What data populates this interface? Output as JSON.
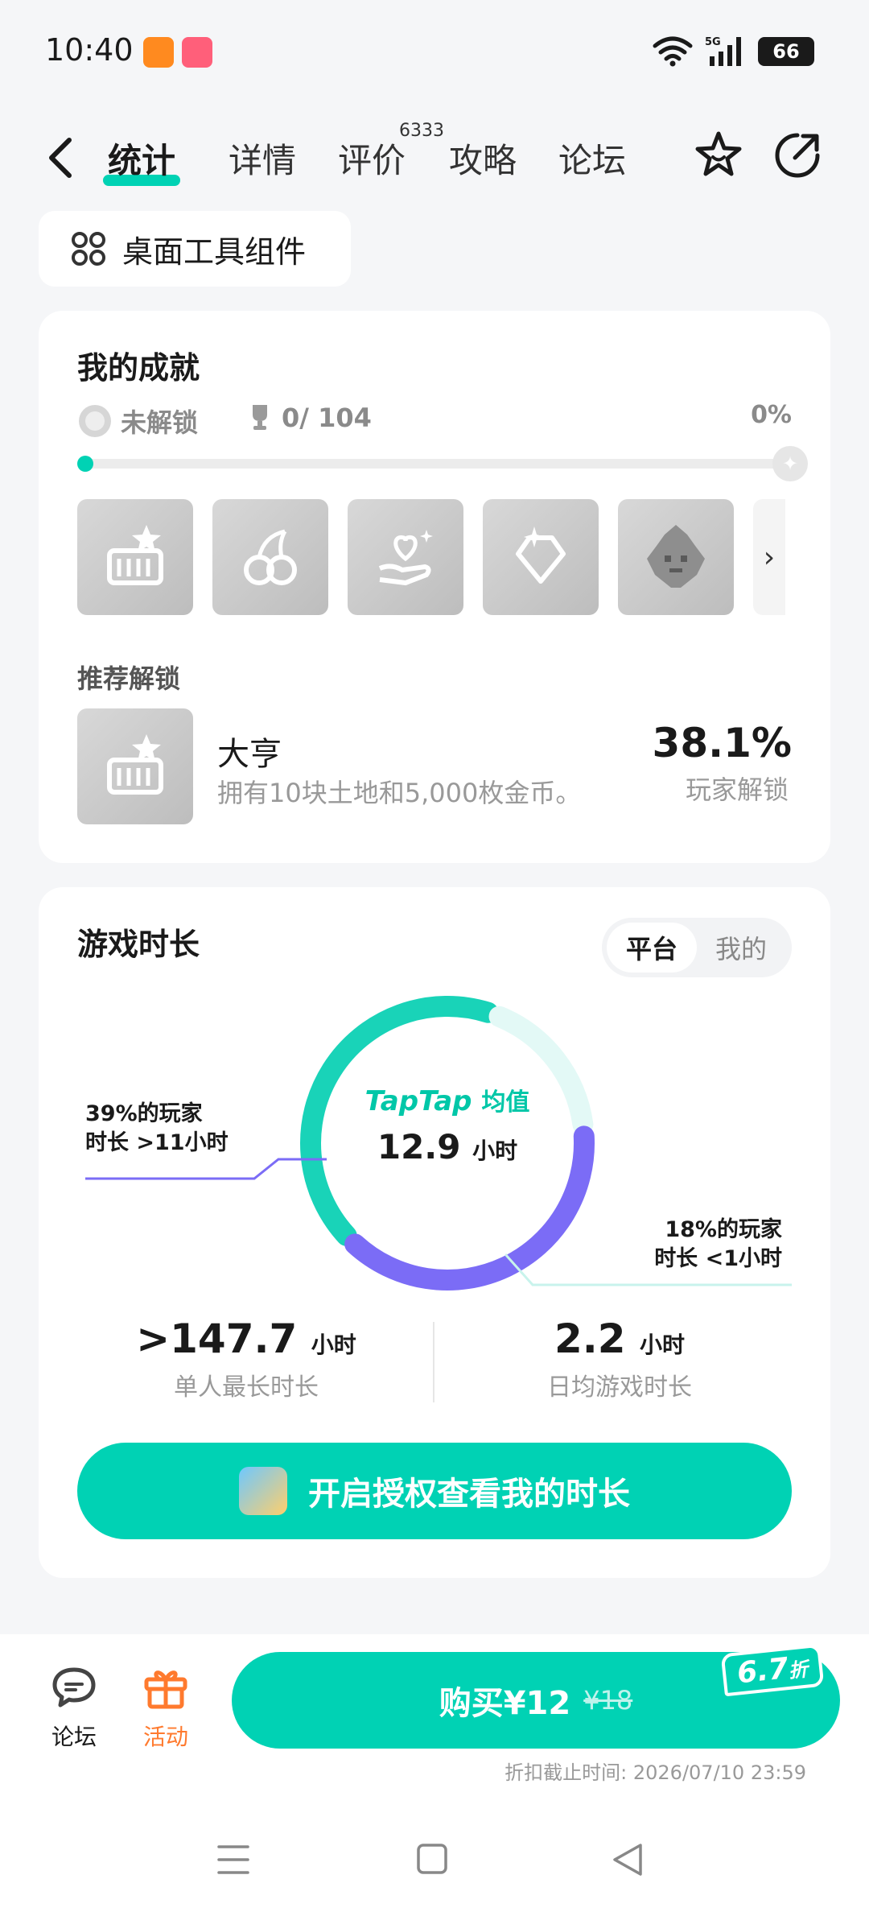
{
  "status_bar": {
    "time": "10:40",
    "battery": "66"
  },
  "nav": {
    "tabs": [
      {
        "label": "统计"
      },
      {
        "label": "详情"
      },
      {
        "label": "评价"
      },
      {
        "label": "攻略"
      },
      {
        "label": "论坛"
      }
    ],
    "review_count": "6333"
  },
  "widget_button": {
    "label": "桌面工具组件"
  },
  "achievements": {
    "title": "我的成就",
    "status": "未解锁",
    "count": "0/ 104",
    "percent": "0%",
    "progress": 0,
    "badge_count": 5,
    "recommend_title": "推荐解锁",
    "recommend": {
      "name": "大亨",
      "desc": "拥有10块土地和5,000枚金币。",
      "percent": "38.1%",
      "percent_label": "玩家解锁"
    }
  },
  "playtime": {
    "title": "游戏时长",
    "segment": {
      "active": "平台",
      "inactive": "我的"
    },
    "brand": "TapTap",
    "brand_sub": "均值",
    "avg_value": "12.9",
    "avg_unit": "小时",
    "annotation_left": {
      "line1": "39%的玩家",
      "line2": "时长 >11小时"
    },
    "annotation_right": {
      "line1": "18%的玩家",
      "line2": "时长 <1小时"
    },
    "max": {
      "value": ">147.7",
      "unit": "小时",
      "label": "单人最长时长"
    },
    "daily": {
      "value": "2.2",
      "unit": "小时",
      "label": "日均游戏时长"
    },
    "auth_button": "开启授权查看我的时长",
    "donut": [
      {
        "name": ">11小时",
        "share": 0.39,
        "color": "#7b6cf6"
      },
      {
        "name": "middle",
        "share": 0.43,
        "color": "#19d3b8"
      },
      {
        "name": "<1小时",
        "share": 0.18,
        "color": "#e3f9f6"
      }
    ]
  },
  "bottom_bar": {
    "forum": "论坛",
    "activity": "活动",
    "buy_label": "购买¥12",
    "original_price": "¥18",
    "discount": "6.7",
    "discount_unit": "折",
    "deadline": "折扣截止时间: 2026/07/10 23:59"
  },
  "colors": {
    "accent": "#00d2b4",
    "purple": "#7b6cf6",
    "orange": "#ff7a2e"
  }
}
